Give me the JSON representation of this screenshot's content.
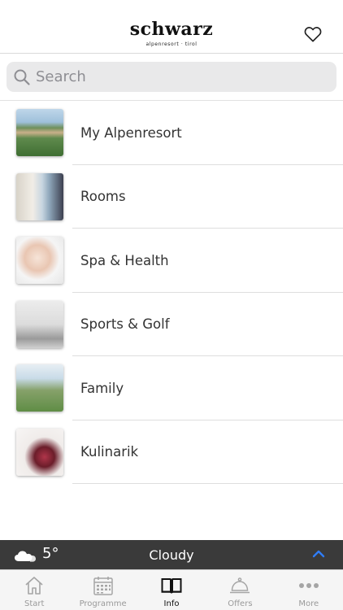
{
  "header": {
    "logo_main": "schwarz",
    "logo_sub": "alpenresort · tirol",
    "favorite_icon": "heart-icon"
  },
  "search": {
    "placeholder": "Search",
    "value": ""
  },
  "items": [
    {
      "label": "My Alpenresort",
      "thumb": "resort-image"
    },
    {
      "label": "Rooms",
      "thumb": "room-image"
    },
    {
      "label": "Spa & Health",
      "thumb": "spa-image"
    },
    {
      "label": "Sports & Golf",
      "thumb": "sports-image"
    },
    {
      "label": "Family",
      "thumb": "family-image"
    },
    {
      "label": "Kulinarik",
      "thumb": "kulinarik-image"
    }
  ],
  "weather": {
    "icon": "cloud-icon",
    "temperature": "5°",
    "condition": "Cloudy",
    "accent": "#2f7cf6"
  },
  "tabs": [
    {
      "label": "Start",
      "icon": "home-icon",
      "active": false
    },
    {
      "label": "Programme",
      "icon": "calendar-icon",
      "active": false
    },
    {
      "label": "Info",
      "icon": "book-icon",
      "active": true
    },
    {
      "label": "Offers",
      "icon": "service-bell-icon",
      "active": false
    },
    {
      "label": "More",
      "icon": "more-dots-icon",
      "active": false
    }
  ]
}
